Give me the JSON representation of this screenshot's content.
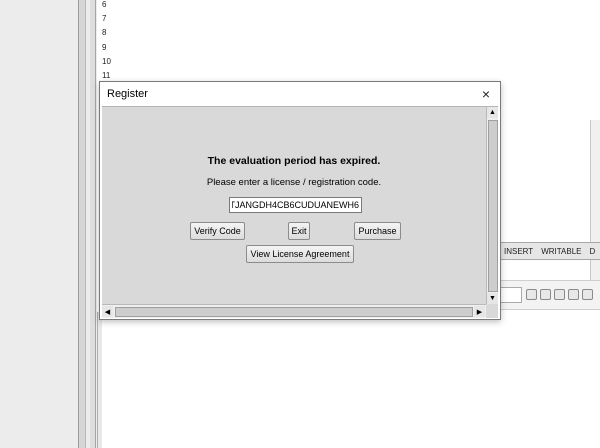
{
  "editor": {
    "line_numbers": [
      "6",
      "7",
      "8",
      "9",
      "10",
      "11"
    ]
  },
  "status_bar": {
    "insert": "INSERT",
    "writable": "WRITABLE",
    "extra": "D"
  },
  "toolbar_icons": [
    "nav-back-icon",
    "nav-forward-icon",
    "copy-icon",
    "edit-icon",
    "paste-icon"
  ],
  "dialog": {
    "title": "Register",
    "close_glyph": "×",
    "headline": "The evaluation period has expired.",
    "prompt": "Please enter a license / registration code.",
    "code_value": "TJANGDH4CB6CUDUANEWH6",
    "buttons": {
      "verify": "Verify Code",
      "exit": "Exit",
      "purchase": "Purchase",
      "agreement": "View License Agreement"
    },
    "scroll_glyphs": {
      "up": "▲",
      "down": "▼",
      "left": "◀",
      "right": "▶"
    }
  }
}
